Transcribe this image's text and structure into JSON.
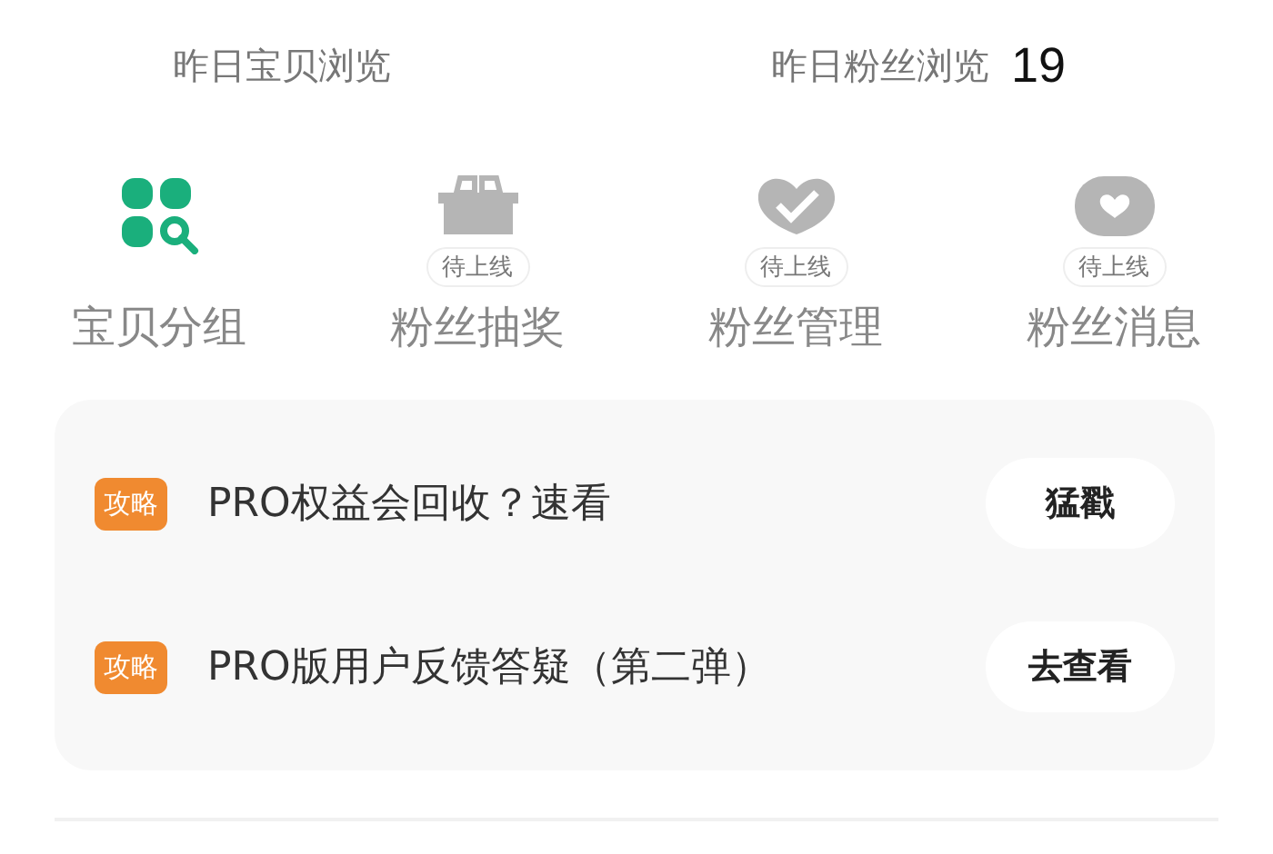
{
  "stats": [
    {
      "label": "昨日宝贝浏览"
    },
    {
      "label": "昨日粉丝浏览",
      "value": "19"
    }
  ],
  "features": [
    {
      "kind": "grid-search",
      "label": "宝贝分组",
      "disabled": false
    },
    {
      "kind": "gift",
      "label": "粉丝抽奖",
      "disabled": true,
      "badge": "待上线"
    },
    {
      "kind": "heart-check",
      "label": "粉丝管理",
      "disabled": true,
      "badge": "待上线"
    },
    {
      "kind": "heart-chat",
      "label": "粉丝消息",
      "disabled": true,
      "badge": "待上线"
    }
  ],
  "tips": [
    {
      "tag": "攻略",
      "title": "PRO权益会回收？速看",
      "action": "猛戳"
    },
    {
      "tag": "攻略",
      "title": "PRO版用户反馈答疑（第二弹）",
      "action": "去查看"
    }
  ]
}
